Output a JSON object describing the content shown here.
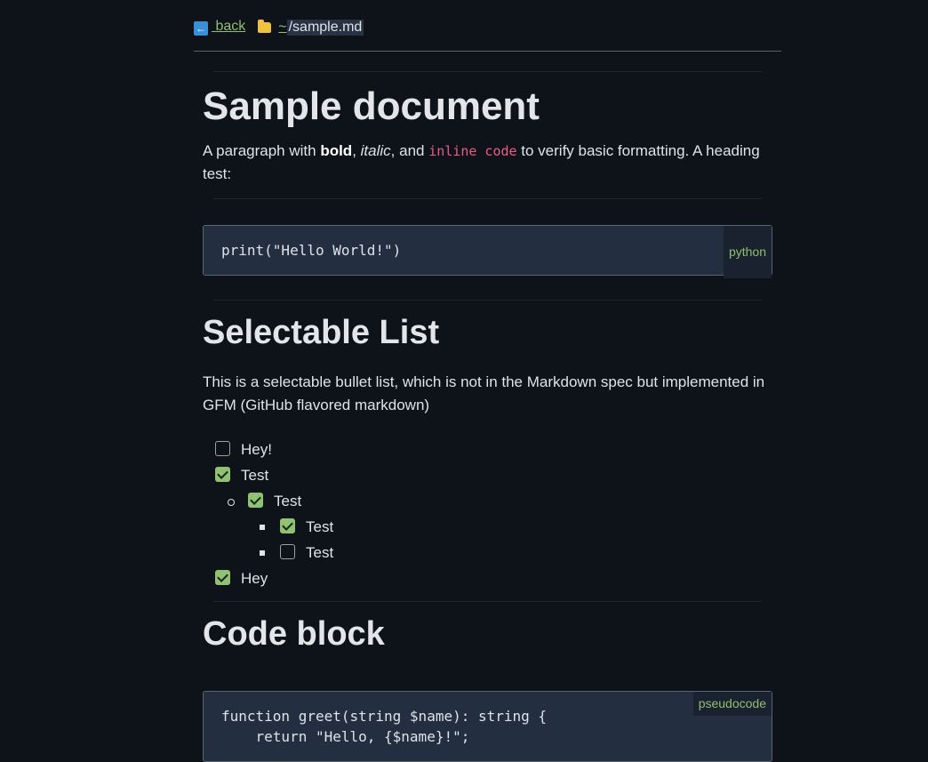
{
  "nav": {
    "back_label": " back ",
    "path_tilde": "~",
    "path_file": "/sample.md"
  },
  "doc": {
    "title": "Sample document",
    "intro": {
      "p1": "A paragraph with ",
      "bold": "bold",
      "p2": ", ",
      "italic": "italic",
      "p3": ", and ",
      "code": "inline code",
      "p4": " to verify basic formatting. A heading test:"
    },
    "code1": {
      "lang": "python",
      "line1": "print(\"Hello World!\")"
    },
    "h_list": "Selectable List",
    "list_desc": "This is a selectable bullet list, which is not in the Markdown spec but implemented in GFM (GitHub flavored markdown)",
    "tasks": [
      {
        "label": "Hey!",
        "checked": false,
        "level": 0
      },
      {
        "label": "Test",
        "checked": true,
        "level": 0
      },
      {
        "label": "Test",
        "checked": true,
        "level": 1
      },
      {
        "label": "Test",
        "checked": true,
        "level": 2
      },
      {
        "label": "Test",
        "checked": false,
        "level": 2
      },
      {
        "label": "Hey",
        "checked": true,
        "level": 0
      }
    ],
    "h_code": "Code block",
    "code2": {
      "lang": "pseudocode",
      "line1": "function greet(string $name): string {",
      "line2": "    return \"Hello, {$name}!\";"
    }
  },
  "colors": {
    "background": "#0e131a",
    "link": "#8fbf6f",
    "inline_code": "#ef5a87",
    "checkbox_on": "#8fc273",
    "code_bg": "#232e40"
  }
}
